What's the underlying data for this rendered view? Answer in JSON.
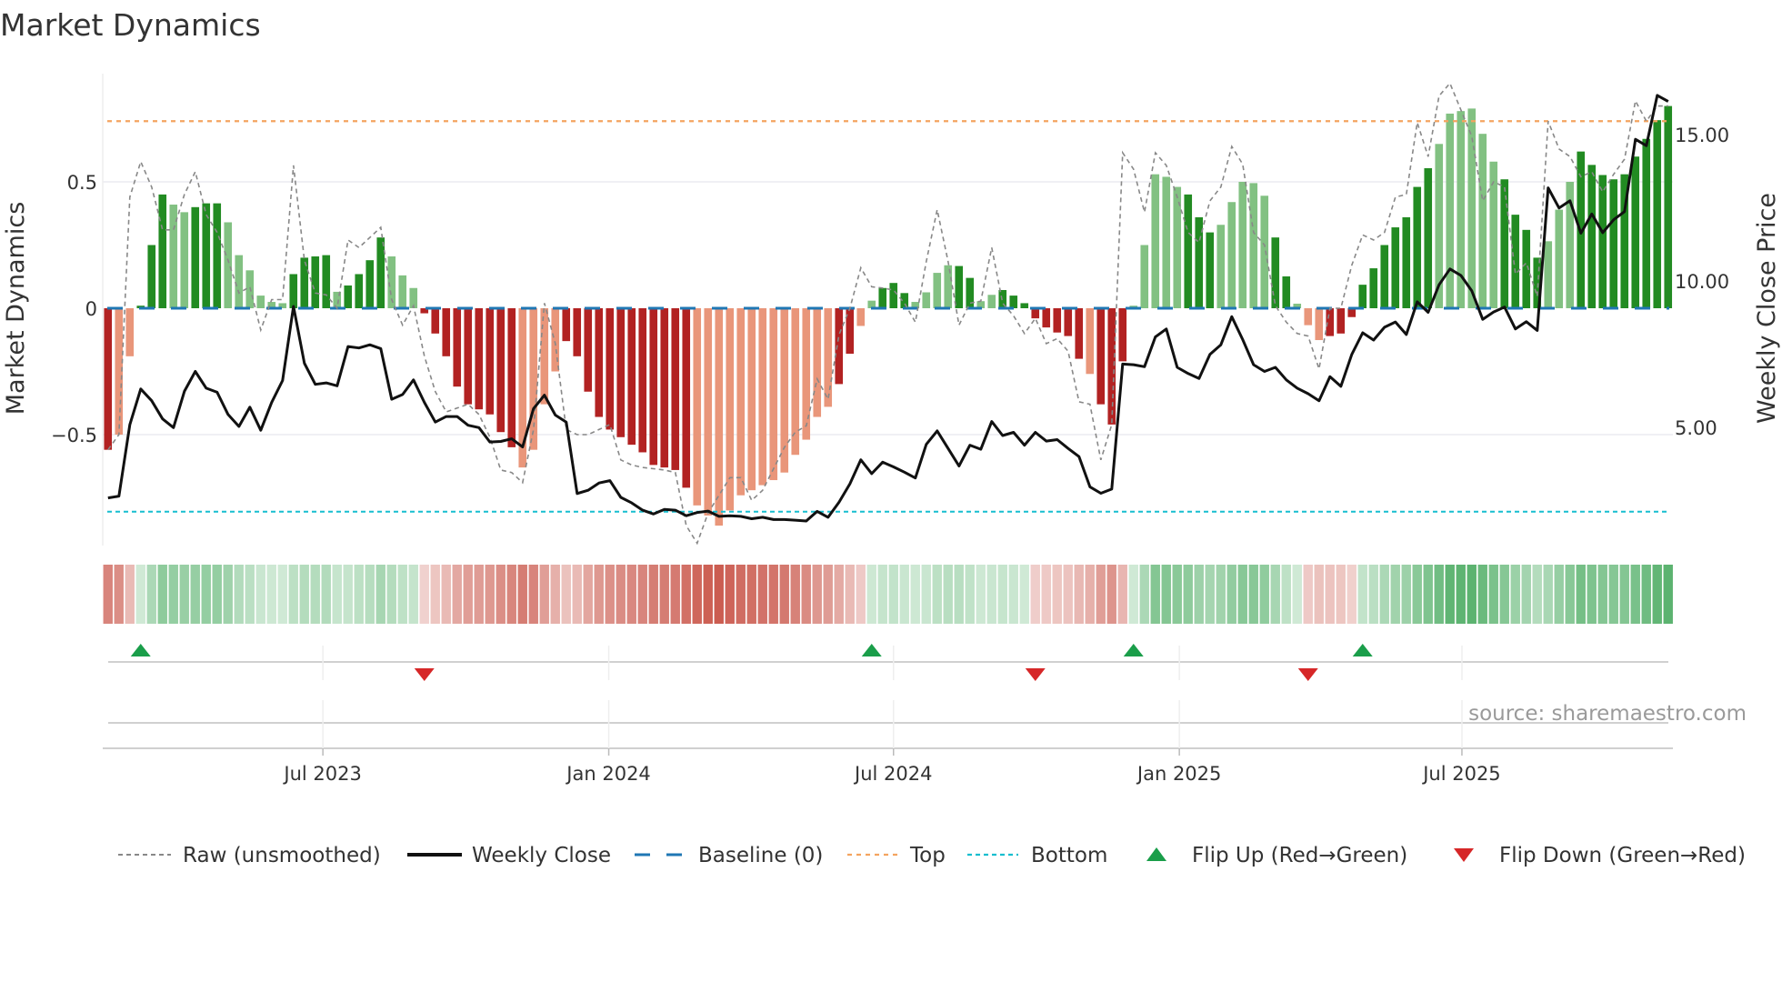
{
  "title": "Market Dynamics",
  "source": "source: sharemaestro.com",
  "colors": {
    "green_strong": "#228b22",
    "green_weak": "#82c182",
    "red_strong": "#b22222",
    "red_weak": "#e9967a",
    "raw": "#888888",
    "close": "#111111",
    "baseline": "#1f77b4",
    "top": "#f4a460",
    "bottom": "#17becf",
    "flip_up": "#1a9e4a",
    "flip_down": "#d62728",
    "heat_green": "#2e9e48",
    "heat_red": "#c0392b"
  },
  "legend": [
    {
      "key": "raw",
      "label": "Raw (unsmoothed)"
    },
    {
      "key": "close",
      "label": "Weekly Close"
    },
    {
      "key": "baseline",
      "label": "Baseline (0)"
    },
    {
      "key": "top",
      "label": "Top"
    },
    {
      "key": "bottom",
      "label": "Bottom"
    },
    {
      "key": "flip_up",
      "label": "Flip Up (Red→Green)"
    },
    {
      "key": "flip_down",
      "label": "Flip Down (Green→Red)"
    }
  ],
  "chart_data": {
    "type": "bar",
    "title": "Market Dynamics",
    "x_unit": "week index",
    "ylabel": "Market Dynamics",
    "y2label": "Weekly Close Price",
    "ylim": [
      -0.93,
      0.93
    ],
    "y2lim": [
      1.5,
      17.0
    ],
    "y_ticks": [
      {
        "value": 0.5,
        "label": "0.5"
      },
      {
        "value": 0,
        "label": "0"
      },
      {
        "value": -0.5,
        "label": "−0.5"
      }
    ],
    "y2_ticks": [
      {
        "value": 5,
        "label": "5.00"
      },
      {
        "value": 10,
        "label": "10.00"
      },
      {
        "value": 15,
        "label": "15.00"
      }
    ],
    "x_ticks": [
      {
        "week": 19.7,
        "label": "Jul 2023"
      },
      {
        "week": 45.9,
        "label": "Jan 2024"
      },
      {
        "week": 72.0,
        "label": "Jul 2024"
      },
      {
        "week": 98.2,
        "label": "Jan 2025"
      },
      {
        "week": 124.1,
        "label": "Jul 2025"
      }
    ],
    "top_level": 0.74,
    "bottom_level": -0.805,
    "baseline": 0,
    "legend_position": "bottom",
    "series": [
      {
        "name": "Market Dynamics",
        "values": [
          -0.56,
          -0.5,
          -0.19,
          0.01,
          0.25,
          0.45,
          0.41,
          0.38,
          0.4,
          0.415,
          0.415,
          0.34,
          0.21,
          0.15,
          0.05,
          0.025,
          0.02,
          0.135,
          0.2,
          0.205,
          0.21,
          0.065,
          0.09,
          0.135,
          0.19,
          0.28,
          0.205,
          0.13,
          0.08,
          -0.02,
          -0.1,
          -0.19,
          -0.31,
          -0.38,
          -0.4,
          -0.42,
          -0.49,
          -0.55,
          -0.63,
          -0.56,
          -0.38,
          -0.25,
          -0.13,
          -0.19,
          -0.33,
          -0.43,
          -0.48,
          -0.51,
          -0.54,
          -0.57,
          -0.62,
          -0.63,
          -0.64,
          -0.71,
          -0.78,
          -0.82,
          -0.86,
          -0.8,
          -0.74,
          -0.72,
          -0.7,
          -0.68,
          -0.65,
          -0.58,
          -0.52,
          -0.43,
          -0.39,
          -0.3,
          -0.18,
          -0.07,
          0.03,
          0.08,
          0.1,
          0.06,
          0.025,
          0.063,
          0.14,
          0.17,
          0.167,
          0.12,
          0.028,
          0.053,
          0.072,
          0.05,
          0.02,
          -0.04,
          -0.076,
          -0.096,
          -0.11,
          -0.2,
          -0.26,
          -0.38,
          -0.46,
          -0.21,
          0.01,
          0.25,
          0.53,
          0.52,
          0.48,
          0.45,
          0.36,
          0.3,
          0.33,
          0.42,
          0.5,
          0.495,
          0.445,
          0.28,
          0.126,
          0.018,
          -0.067,
          -0.126,
          -0.11,
          -0.1,
          -0.035,
          0.093,
          0.158,
          0.25,
          0.32,
          0.36,
          0.48,
          0.554,
          0.65,
          0.77,
          0.78,
          0.79,
          0.69,
          0.58,
          0.51,
          0.37,
          0.31,
          0.2,
          0.265,
          0.39,
          0.5,
          0.62,
          0.567,
          0.527,
          0.51,
          0.53,
          0.6,
          0.67,
          0.744,
          0.8
        ],
        "shade": "dlldddlldddllllllddddlddddllldddddddddllllddddddddddddlllllllllllllddlldddllllddllddddddddldddllllldddllllldd lllddddddddddllllllddddllldddd"
      },
      {
        "name": "Raw (unsmoothed)",
        "values": [
          -0.56,
          -0.5,
          0.44,
          0.58,
          0.48,
          0.31,
          0.31,
          0.45,
          0.54,
          0.37,
          0.3,
          0.19,
          0.06,
          0.085,
          -0.086,
          0.034,
          0.034,
          0.565,
          0.19,
          0.06,
          0.053,
          0,
          0.27,
          0.24,
          0.28,
          0.32,
          0.034,
          -0.067,
          0.01,
          -0.19,
          -0.33,
          -0.41,
          -0.395,
          -0.38,
          -0.42,
          -0.51,
          -0.64,
          -0.65,
          -0.69,
          -0.48,
          0.02,
          -0.14,
          -0.48,
          -0.5,
          -0.5,
          -0.48,
          -0.46,
          -0.6,
          -0.62,
          -0.63,
          -0.635,
          -0.64,
          -0.65,
          -0.86,
          -0.93,
          -0.81,
          -0.74,
          -0.67,
          -0.67,
          -0.76,
          -0.72,
          -0.635,
          -0.55,
          -0.49,
          -0.465,
          -0.28,
          -0.36,
          -0.105,
          0,
          0.16,
          0.085,
          0.08,
          0.072,
          0.02,
          -0.055,
          0.185,
          0.39,
          0.185,
          -0.067,
          0.02,
          0.028,
          0.24,
          0.02,
          -0.03,
          -0.1,
          -0.04,
          -0.14,
          -0.12,
          -0.17,
          -0.37,
          -0.38,
          -0.6,
          -0.46,
          0.615,
          0.55,
          0.38,
          0.615,
          0.565,
          0.44,
          0.3,
          0.26,
          0.425,
          0.48,
          0.64,
          0.57,
          0.3,
          0.25,
          0.01,
          -0.055,
          -0.1,
          -0.11,
          -0.24,
          0,
          0,
          0.17,
          0.29,
          0.27,
          0.3,
          0.44,
          0.45,
          0.735,
          0.6,
          0.84,
          0.89,
          0.785,
          0.68,
          0.425,
          0.5,
          0.48,
          0.135,
          0.18,
          0.047,
          0.74,
          0.63,
          0.6,
          0.52,
          0.54,
          0.46,
          0.53,
          0.59,
          0.82,
          0.74,
          0.8,
          0.8
        ]
      },
      {
        "name": "Weekly Close",
        "axis": "right",
        "values": [
          2.59,
          2.65,
          5.09,
          6.31,
          5.91,
          5.29,
          4.99,
          6.23,
          6.91,
          6.34,
          6.2,
          5.44,
          5.03,
          5.69,
          4.9,
          5.85,
          6.6,
          9.13,
          7.19,
          6.47,
          6.52,
          6.42,
          7.76,
          7.71,
          7.82,
          7.69,
          5.96,
          6.12,
          6.62,
          5.85,
          5.18,
          5.37,
          5.37,
          5.07,
          4.99,
          4.5,
          4.52,
          4.61,
          4.33,
          5.64,
          6.1,
          5.42,
          5.18,
          2.74,
          2.85,
          3.1,
          3.18,
          2.61,
          2.42,
          2.17,
          2.04,
          2.2,
          2.17,
          1.98,
          2.09,
          2.14,
          1.96,
          1.98,
          1.96,
          1.88,
          1.93,
          1.85,
          1.85,
          1.83,
          1.8,
          2.13,
          1.93,
          2.44,
          3.07,
          3.89,
          3.42,
          3.81,
          3.65,
          3.47,
          3.27,
          4.42,
          4.88,
          4.28,
          3.68,
          4.39,
          4.25,
          5.2,
          4.72,
          4.83,
          4.39,
          4.83,
          4.53,
          4.58,
          4.28,
          4.0,
          2.97,
          2.75,
          2.89,
          7.16,
          7.14,
          7.07,
          8.09,
          8.36,
          7.05,
          6.84,
          6.67,
          7.49,
          7.82,
          8.78,
          8.0,
          7.14,
          6.91,
          7.05,
          6.62,
          6.34,
          6.15,
          5.91,
          6.73,
          6.4,
          7.49,
          8.23,
          7.98,
          8.42,
          8.6,
          8.17,
          9.29,
          8.93,
          9.87,
          10.41,
          10.19,
          9.66,
          8.69,
          8.94,
          9.11,
          8.36,
          8.61,
          8.31,
          13.18,
          12.49,
          12.74,
          11.63,
          12.29,
          11.65,
          12.09,
          12.37,
          14.84,
          14.62,
          16.34,
          16.13
        ]
      }
    ],
    "flip_up_weeks": [
      3,
      70,
      94,
      115
    ],
    "flip_down_weeks": [
      29,
      85,
      110
    ]
  }
}
